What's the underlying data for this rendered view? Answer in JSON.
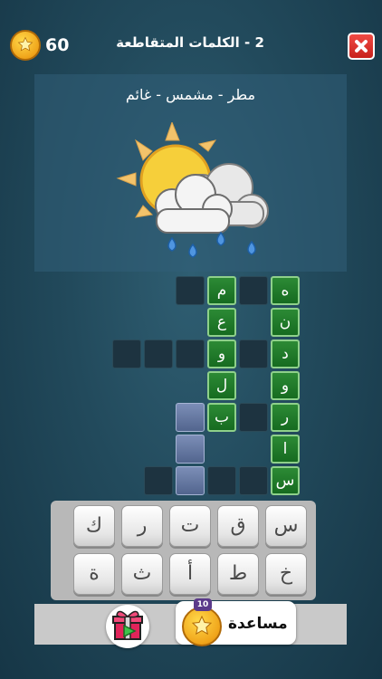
{
  "header": {
    "coins": "60",
    "level_title": "2 - الكلمات المتقاطعة",
    "close_icon": "close-x-icon"
  },
  "clue": {
    "hint": "مطر - مشمس - غائم",
    "image": "sun-behind-rain-cloud"
  },
  "grid": {
    "cells": [
      {
        "id": "r1c6",
        "row": 1,
        "col": 6,
        "letter": "",
        "state": "empty"
      },
      {
        "id": "r1c7",
        "row": 1,
        "col": 7,
        "letter": "م",
        "state": "filled"
      },
      {
        "id": "r1c8",
        "row": 1,
        "col": 8,
        "letter": "",
        "state": "empty"
      },
      {
        "id": "r1c9",
        "row": 1,
        "col": 9,
        "letter": "ه",
        "state": "filled"
      },
      {
        "id": "r2c7",
        "row": 2,
        "col": 7,
        "letter": "ع",
        "state": "filled"
      },
      {
        "id": "r2c9",
        "row": 2,
        "col": 9,
        "letter": "ن",
        "state": "filled"
      },
      {
        "id": "r3c4",
        "row": 3,
        "col": 4,
        "letter": "",
        "state": "empty"
      },
      {
        "id": "r3c5",
        "row": 3,
        "col": 5,
        "letter": "",
        "state": "empty"
      },
      {
        "id": "r3c6",
        "row": 3,
        "col": 6,
        "letter": "",
        "state": "empty"
      },
      {
        "id": "r3c7",
        "row": 3,
        "col": 7,
        "letter": "و",
        "state": "filled"
      },
      {
        "id": "r3c8",
        "row": 3,
        "col": 8,
        "letter": "",
        "state": "empty"
      },
      {
        "id": "r3c9",
        "row": 3,
        "col": 9,
        "letter": "د",
        "state": "filled"
      },
      {
        "id": "r4c7",
        "row": 4,
        "col": 7,
        "letter": "ل",
        "state": "filled"
      },
      {
        "id": "r4c9",
        "row": 4,
        "col": 9,
        "letter": "و",
        "state": "filled"
      },
      {
        "id": "r5c6",
        "row": 5,
        "col": 6,
        "letter": "",
        "state": "selected"
      },
      {
        "id": "r5c7",
        "row": 5,
        "col": 7,
        "letter": "ب",
        "state": "filled"
      },
      {
        "id": "r5c8",
        "row": 5,
        "col": 8,
        "letter": "",
        "state": "empty"
      },
      {
        "id": "r5c9",
        "row": 5,
        "col": 9,
        "letter": "ر",
        "state": "filled"
      },
      {
        "id": "r6c6",
        "row": 6,
        "col": 6,
        "letter": "",
        "state": "selected"
      },
      {
        "id": "r6c9",
        "row": 6,
        "col": 9,
        "letter": "ا",
        "state": "filled"
      },
      {
        "id": "r7c5",
        "row": 7,
        "col": 5,
        "letter": "",
        "state": "empty"
      },
      {
        "id": "r7c6",
        "row": 7,
        "col": 6,
        "letter": "",
        "state": "selected"
      },
      {
        "id": "r7c7",
        "row": 7,
        "col": 7,
        "letter": "",
        "state": "empty"
      },
      {
        "id": "r7c8",
        "row": 7,
        "col": 8,
        "letter": "",
        "state": "empty"
      },
      {
        "id": "r7c9",
        "row": 7,
        "col": 9,
        "letter": "س",
        "state": "filled"
      }
    ]
  },
  "keyboard": {
    "row1": [
      "ك",
      "ر",
      "ت",
      "ق",
      "س"
    ],
    "row2": [
      "ة",
      "ث",
      "أ",
      "ط",
      "خ"
    ]
  },
  "bottom": {
    "gift_icon": "gift-box-icon",
    "help_cost": "10",
    "help_label": "مساعدة",
    "help_icon": "star-coin-icon"
  }
}
